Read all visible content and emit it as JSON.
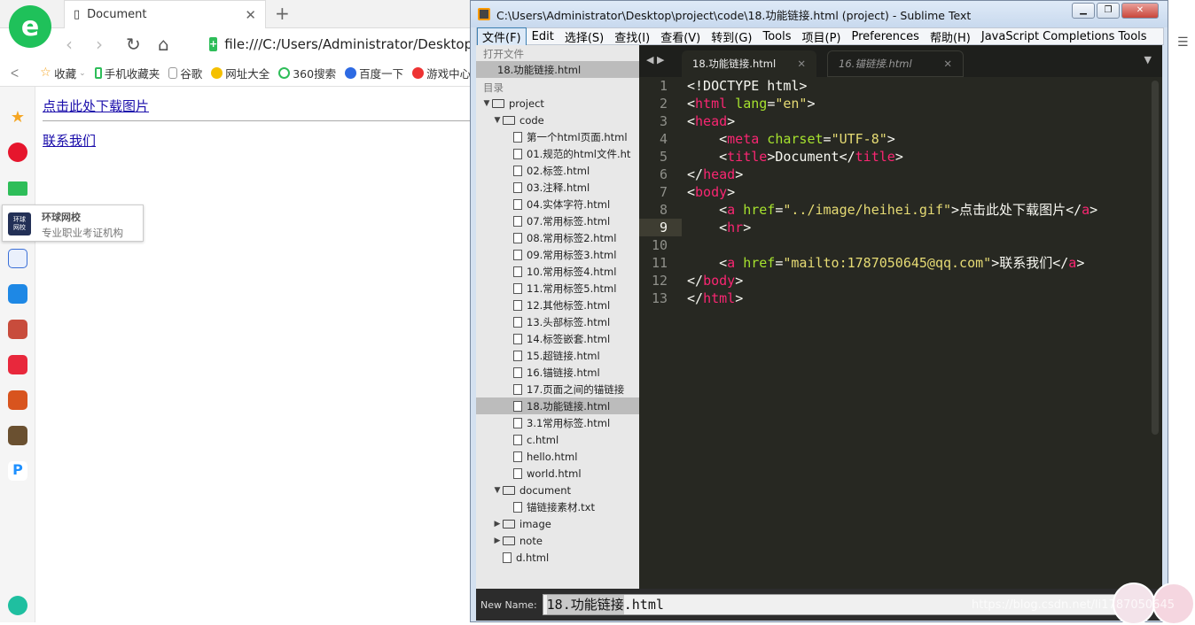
{
  "browser": {
    "tab_title": "Document",
    "url": "file:///C:/Users/Administrator/Desktop/p",
    "bookmarks": [
      "收藏",
      "手机收藏夹",
      "谷歌",
      "网址大全",
      "360搜索",
      "百度一下",
      "游戏中心"
    ],
    "tooltip": {
      "title": "环球网校",
      "subtitle": "专业职业考证机构",
      "icon_text": "环球\n网校"
    },
    "page": {
      "link1": "点击此处下载图片",
      "link2": "联系我们"
    }
  },
  "sublime": {
    "title": "C:\\Users\\Administrator\\Desktop\\project\\code\\18.功能链接.html (project) - Sublime Text",
    "menu": [
      "文件(F)",
      "Edit",
      "选择(S)",
      "查找(I)",
      "查看(V)",
      "转到(G)",
      "Tools",
      "项目(P)",
      "Preferences",
      "帮助(H)",
      "JavaScript Completions Tools"
    ],
    "sidebar": {
      "open_files_header": "打开文件",
      "open_file": "18.功能链接.html",
      "folders_header": "目录",
      "tree": [
        "project",
        "code",
        "第一个html页面.html",
        "01.规范的html文件.ht",
        "02.标签.html",
        "03.注释.html",
        "04.实体字符.html",
        "07.常用标签.html",
        "08.常用标签2.html",
        "09.常用标签3.html",
        "10.常用标签4.html",
        "11.常用标签5.html",
        "12.其他标签.html",
        "13.头部标签.html",
        "14.标签嵌套.html",
        "15.超链接.html",
        "16.锚链接.html",
        "17.页面之间的锚链接",
        "18.功能链接.html",
        "3.1常用标签.html",
        "c.html",
        "hello.html",
        "world.html",
        "document",
        "锚链接素材.txt",
        "image",
        "note",
        "d.html"
      ]
    },
    "tabs": [
      "18.功能链接.html",
      "16.锚链接.html"
    ],
    "code": {
      "line_numbers": [
        "1",
        "2",
        "3",
        "4",
        "5",
        "6",
        "7",
        "8",
        "9",
        "10",
        "11",
        "12",
        "13"
      ],
      "l1": "<!DOCTYPE html>",
      "l2a": "<",
      "l2b": "html",
      "l2c": " lang",
      "l2d": "=",
      "l2e": "\"en\"",
      "l2f": ">",
      "l4a": "    <",
      "l4b": "meta",
      "l4c": " charset",
      "l4d": "=",
      "l4e": "\"UTF-8\"",
      "l4f": ">",
      "l5a": "    <",
      "l5b": "title",
      "l5c": ">Document</",
      "l5d": "title",
      "l5e": ">",
      "l8a": "    <",
      "l8b": "a",
      "l8c": " href",
      "l8d": "=",
      "l8e": "\"../image/heihei.gif\"",
      "l8f": ">点击此处下载图片</",
      "l8g": "a",
      "l8h": ">",
      "l9a": "    <",
      "l9b": "hr",
      "l9c": ">",
      "l11a": "    <",
      "l11b": "a",
      "l11c": " href",
      "l11d": "=",
      "l11e": "\"mailto:1787050645@qq.com\"",
      "l11f": ">联系我们</",
      "l11g": "a",
      "l11h": ">",
      "head": "head",
      "body": "body",
      "html": "html"
    },
    "status": {
      "label": "New Name:",
      "value_selected": "18.功能链接",
      "value_rest": ".html"
    }
  },
  "watermark": "https://blog.csdn.net/li1787050645",
  "colors": {
    "accent_green": "#1fc15a",
    "editor_bg": "#272822",
    "tag": "#f92672",
    "attr": "#a6e22e",
    "string": "#e6db74"
  }
}
